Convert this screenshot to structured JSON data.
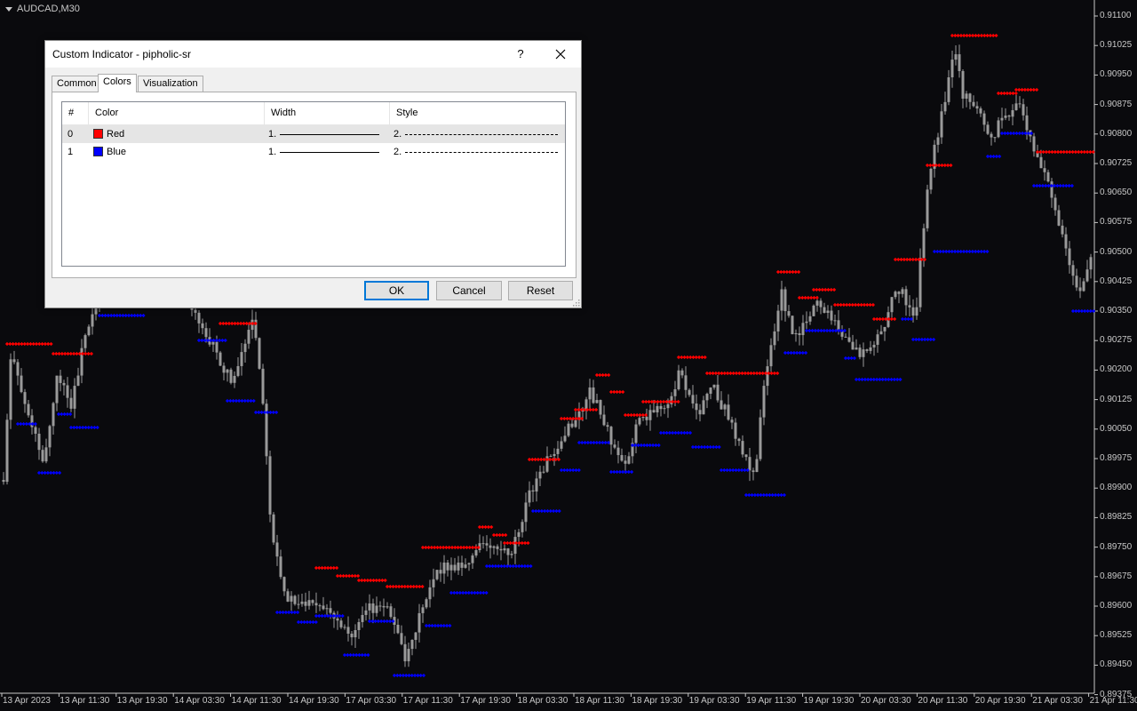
{
  "chart": {
    "symbol": "AUDCAD,M30",
    "background_color": "#0a0a0d",
    "candle_color": "#9a9a9a",
    "resistance_color": "#ff0000",
    "support_color": "#0000ff",
    "price_labels": [
      "0.91100",
      "0.91025",
      "0.90950",
      "0.90875",
      "0.90800",
      "0.90725",
      "0.90650",
      "0.90575",
      "0.90500",
      "0.90425",
      "0.90350",
      "0.90275",
      "0.90200",
      "0.90125",
      "0.90050",
      "0.89975",
      "0.89900",
      "0.89825",
      "0.89750",
      "0.89675",
      "0.89600",
      "0.89525",
      "0.89450",
      "0.89375"
    ],
    "time_labels": [
      "13 Apr 2023",
      "13 Apr 11:30",
      "13 Apr 19:30",
      "14 Apr 03:30",
      "14 Apr 11:30",
      "14 Apr 19:30",
      "17 Apr 03:30",
      "17 Apr 11:30",
      "17 Apr 19:30",
      "18 Apr 03:30",
      "18 Apr 11:30",
      "18 Apr 19:30",
      "19 Apr 03:30",
      "19 Apr 11:30",
      "19 Apr 19:30",
      "20 Apr 03:30",
      "20 Apr 11:30",
      "20 Apr 19:30",
      "21 Apr 03:30",
      "21 Apr 11:30"
    ]
  },
  "dialog": {
    "title": "Custom Indicator - pipholic-sr",
    "help_label": "?",
    "tabs": [
      {
        "label": "Common",
        "active": false
      },
      {
        "label": "Colors",
        "active": true
      },
      {
        "label": "Visualization",
        "active": false
      }
    ],
    "table": {
      "headers": [
        "#",
        "Color",
        "Width",
        "Style"
      ],
      "rows": [
        {
          "index": "0",
          "color_name": "Red",
          "color": "#ff0000",
          "width": "1.",
          "style": "2."
        },
        {
          "index": "1",
          "color_name": "Blue",
          "color": "#0000ff",
          "width": "1.",
          "style": "2."
        }
      ]
    },
    "buttons": {
      "ok": "OK",
      "cancel": "Cancel",
      "reset": "Reset"
    }
  }
}
